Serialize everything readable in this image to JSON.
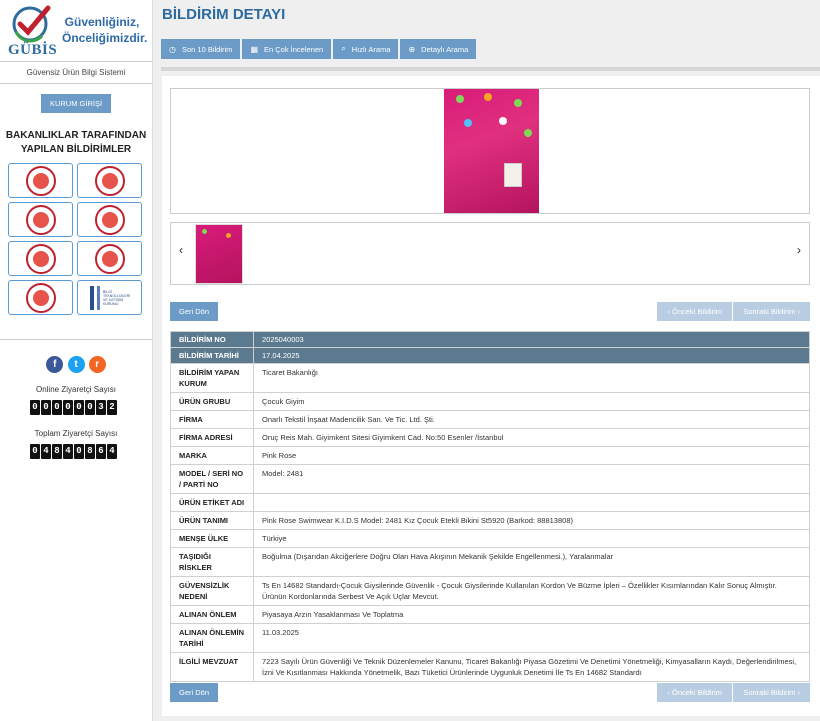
{
  "brand": {
    "logo_word": "GÜBİS",
    "slogan_line1": "Güvenliğiniz,",
    "slogan_line2": "Önceliğimizdir.",
    "subtitle": "Güvensiz Ürün Bilgi Sistemi"
  },
  "sidebar": {
    "kurum_login": "KURUM GİRİŞİ",
    "ministries_title_line1": "BAKANLIKLAR TARAFINDAN",
    "ministries_title_line2": "YAPILAN BİLDİRİMLER",
    "btk_text": "BİLGİ TEKNOLOJİLERİ VE İLETİŞİM KURUMU",
    "social": {
      "facebook": "f",
      "twitter": "t",
      "rss": "r"
    },
    "online_label": "Online Ziyaretçi Sayısı",
    "online_digits": [
      "0",
      "0",
      "0",
      "0",
      "0",
      "0",
      "3",
      "2"
    ],
    "total_label": "Toplam Ziyaretçi Sayısı",
    "total_digits": [
      "0",
      "4",
      "8",
      "4",
      "0",
      "8",
      "6",
      "4"
    ]
  },
  "page": {
    "title": "BİLDİRİM DETAYI"
  },
  "toolbar": {
    "son10": "Son 10 Bildirim",
    "en_cok": "En Çok İncelenen",
    "hizli": "Hızlı Arama",
    "detayli": "Detaylı Arama"
  },
  "gallery": {
    "prev": "‹",
    "next": "›"
  },
  "nav": {
    "back": "Geri Dön",
    "prev": "‹ Önceki Bildirim",
    "next": "Sonraki Bildirim ›"
  },
  "details": {
    "rows": [
      {
        "key": "BİLDİRİM NO",
        "value": "2025040003"
      },
      {
        "key": "BİLDİRİM TARİHİ",
        "value": "17.04.2025"
      },
      {
        "key": "BİLDİRİM YAPAN KURUM",
        "value": "Ticaret Bakanlığı"
      },
      {
        "key": "ÜRÜN GRUBU",
        "value": "Çocuk Giyim"
      },
      {
        "key": "FİRMA",
        "value": "Onarlı Tekstil İnşaat Madencilik San. Ve Tic. Ltd. Şti."
      },
      {
        "key": "FİRMA ADRESİ",
        "value": "Oruç Reis Mah. Giyimkent Sitesi Giyimkent Cad. No:50 Esenler /İstanbul"
      },
      {
        "key": "MARKA",
        "value": "Pink Rose"
      },
      {
        "key": "MODEL / SERİ NO / PARTİ NO",
        "value": "Model: 2481"
      },
      {
        "key": "ÜRÜN ETİKET ADI",
        "value": ""
      },
      {
        "key": "ÜRÜN TANIMI",
        "value": "Pink Rose Swimwear K.I.D.S Model: 2481 Kız Çocuk Etekli Bikini St5920 (Barkod: 88813808)"
      },
      {
        "key": "MENŞE ÜLKE",
        "value": "Türkiye"
      },
      {
        "key": "TAŞIDIĞI RİSKLER",
        "value": "Boğulma (Dışarıdan Akciğerlere Doğru Olan Hava Akışının Mekanik Şekilde Engellenmesi.), Yaralanmalar"
      },
      {
        "key": "GÜVENSİZLİK NEDENİ",
        "value": "Ts En 14682 Standardı-Çocuk Giysilerinde Güvenlik - Çocuk Giysilerinde Kullanılan Kordon Ve Büzme İpleri – Özellikler Kısımlarından Kalır Sonuç Almıştır. Ürünün Kordonlarında Serbest Ve Açık Uçlar Mevcut."
      },
      {
        "key": "ALINAN ÖNLEM",
        "value": "Piyasaya Arzın Yasaklanması Ve Toplatma"
      },
      {
        "key": "ALINAN ÖNLEMİN TARİHİ",
        "value": "11.03.2025"
      },
      {
        "key": "İLGİLİ MEVZUAT",
        "value": "7223 Sayılı Ürün Güvenliği Ve Teknik Düzenlemeler Kanunu, Ticaret Bakanlığı Piyasa Gözetimi Ve Denetimi Yönetmeliği, Kimyasalların Kaydı, Değerlendirilmesi, İzni Ve Kısıtlanması Hakkında Yönetmelik, Bazı Tüketici Ürünlerinde Uygunluk Denetimi İle Ts En 14682 Standardı"
      }
    ]
  },
  "colors": {
    "accent": "#6b9bc6",
    "title": "#2c6aa0",
    "header_row": "#5c7a8f",
    "disabled": "#b9cde2"
  }
}
